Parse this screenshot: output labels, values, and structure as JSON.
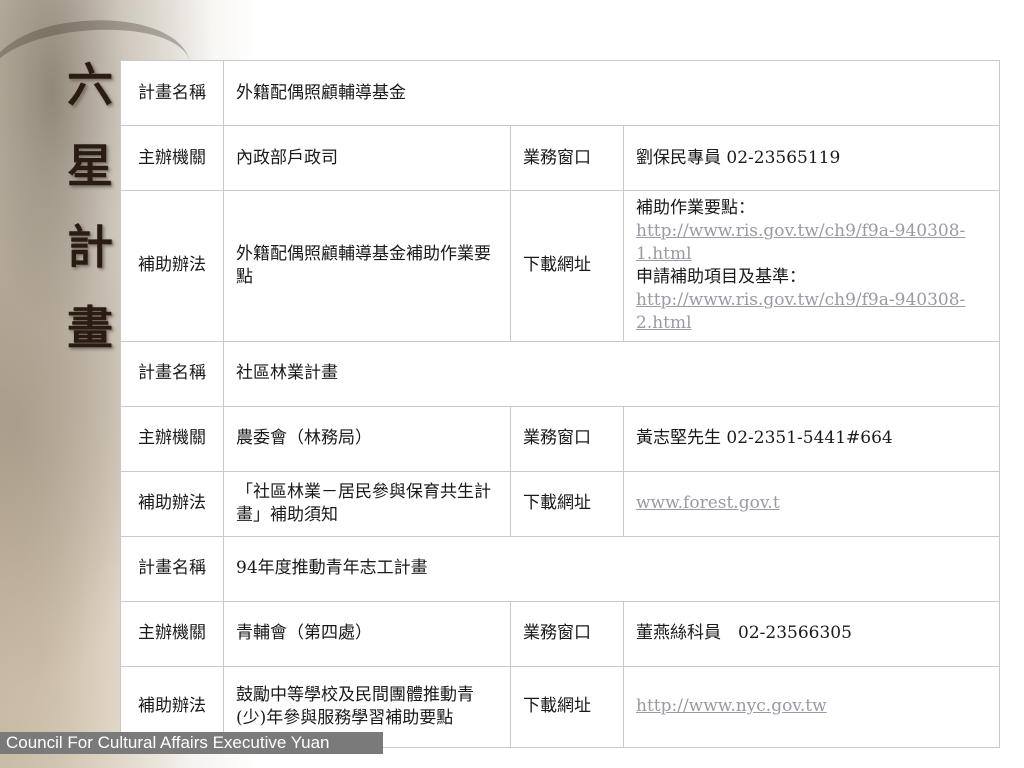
{
  "side_title": [
    "六",
    "星",
    "計",
    "畫"
  ],
  "footer": "Council For Cultural Affairs Executive Yuan",
  "labels": {
    "plan_name": "計畫名稱",
    "organizer": "主辦機關",
    "contact_window": "業務窗口",
    "subsidy_method": "補助辦法",
    "download_url": "下載網址"
  },
  "plans": [
    {
      "name": "外籍配偶照顧輔導基金",
      "organizer": "內政部戶政司",
      "contact": "劉保民專員  02-23565119",
      "subsidy": "外籍配偶照顧輔導基金補助作業要點",
      "download_heading_1": "補助作業要點：",
      "download_link_1": "http://www.ris.gov.tw/ch9/f9a-940308-1.html",
      "download_heading_2": "申請補助項目及基準：",
      "download_link_2": "http://www.ris.gov.tw/ch9/f9a-940308-2.html"
    },
    {
      "name": "社區林業計畫",
      "organizer": "農委會（林務局）",
      "contact": "黃志堅先生 02-2351-5441#664",
      "subsidy": "「社區林業－居民參與保育共生計畫」補助須知",
      "download_link": "www.forest.gov.t"
    },
    {
      "name": "94年度推動青年志工計畫",
      "organizer": "青輔會（第四處）",
      "contact": "董燕絲科員　02-23566305",
      "subsidy": "鼓勵中等學校及民間團體推動青(少)年參與服務學習補助要點",
      "download_link": "http://www.nyc.gov.tw"
    }
  ]
}
